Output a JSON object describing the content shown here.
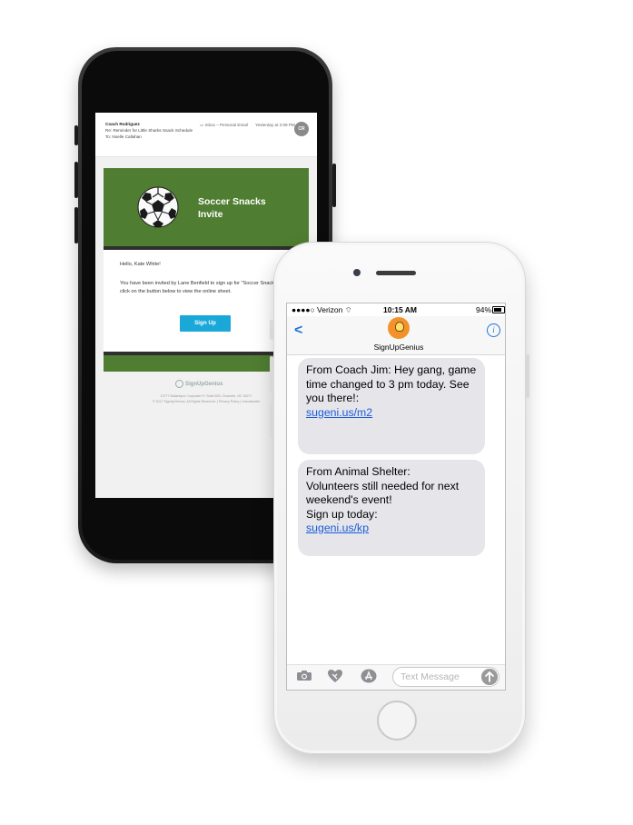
{
  "email": {
    "from": "Coach Rodriguez",
    "re_label": "Re:",
    "subject": "Reminder for Little Sharks Snack Schedule",
    "to_label": "To:",
    "to": "Noelle Callahan",
    "folder": "Inbox – Personal Email",
    "date": "Yesterday at 2:09 PM",
    "avatar_initials": "CR",
    "banner_title": "Soccer Snacks Invite",
    "greeting": "Hello, Kate White!",
    "body": "You have been invited by Lane Benfield to sign up for \"Soccer Snacks\". Please click on the button below to view the online sheet.",
    "button": "Sign Up",
    "footer_logo": "SignUpGenius",
    "footer_line1": "13777 Ballantyne Corporate Pl. Suite 600, Charlotte, NC 28277",
    "footer_line2": "© 2017 SignUpGenius. All Rights Reserved. | Privacy Policy | Unsubscribe"
  },
  "sms": {
    "carrier": "●●●●○ Verizon",
    "time": "10:15 AM",
    "battery": "94%",
    "contact": "SignUpGenius",
    "messages": [
      {
        "text": "From Coach Jim: Hey gang, game time changed to 3 pm today. See you there!:",
        "link": "sugeni.us/m2"
      },
      {
        "text1": "From Animal Shelter:",
        "text2": "Volunteers still needed for next weekend's event!",
        "text3": "Sign up today:",
        "link": "sugeni.us/kp"
      }
    ],
    "input_placeholder": "Text Message"
  }
}
